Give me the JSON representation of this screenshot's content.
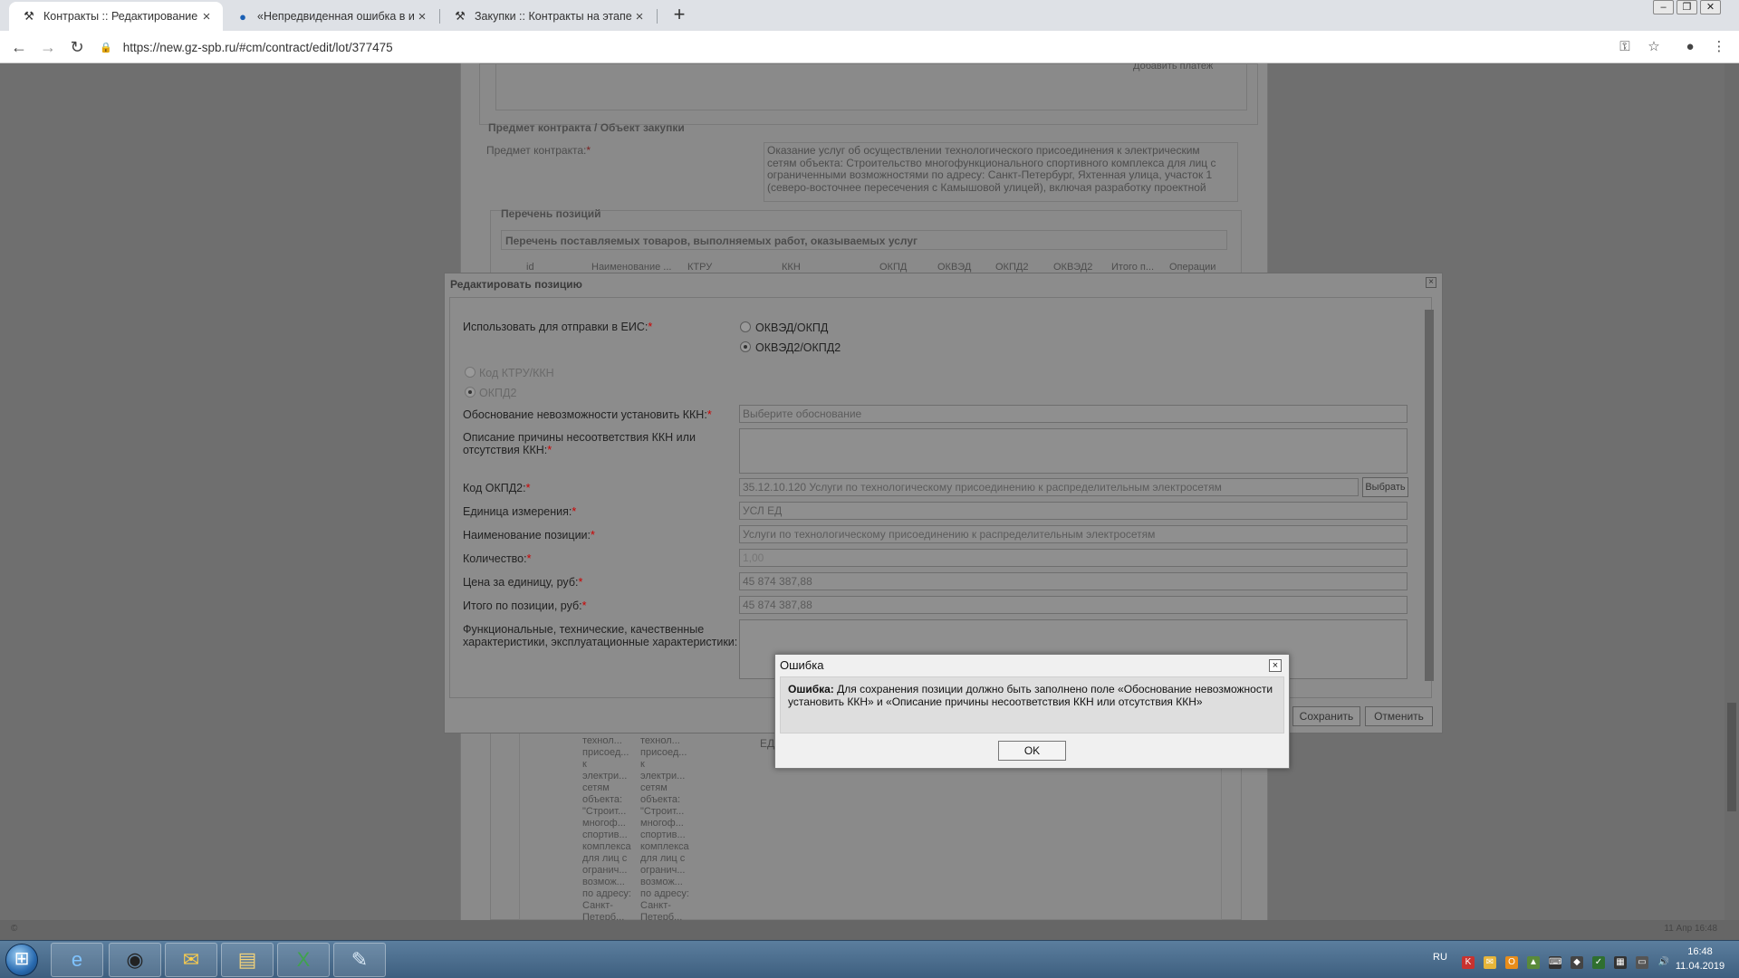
{
  "browser": {
    "tabs": [
      {
        "label": "Контракты :: Редактирование ко",
        "icon": "tool-icon",
        "active": true
      },
      {
        "label": "«Непредвиденная ошибка в ин",
        "icon": "globe-icon",
        "active": false
      },
      {
        "label": "Закупки :: Контракты на этапе и",
        "icon": "tool-icon",
        "active": false
      }
    ],
    "url": "https://new.gz-spb.ru/#cm/contract/edit/lot/377475"
  },
  "background": {
    "add_payment_btn": "Добавить платеж",
    "section_subject": "Предмет контракта / Объект закупки",
    "subject_label": "Предмет контракта:",
    "subject_text": "Оказание услуг об осуществлении технологического присоединения к электрическим сетям объекта: Строительство многофункционального спортивного комплекса для лиц с ограниченными возможностями по адресу: Санкт-Петербург, Яхтенная улица, участок 1 (северо-восточнее пересечения с Камышовой улицей), включая разработку проектной",
    "positions_section": "Перечень позиций",
    "positions_table_title": "Перечень поставляемых товаров, выполняемых работ, оказываемых услуг",
    "columns": [
      "id",
      "Наименование ...",
      "КТРУ",
      "ККН",
      "ОКПД",
      "ОКВЭД",
      "ОКПД2",
      "ОКВЭД2",
      "Итого п...",
      "Операции"
    ],
    "cell_col1": [
      "технол...",
      "присоед...",
      "к",
      "электри...",
      "сетям",
      "объекта:",
      "\"Строит...",
      "многоф...",
      "спортив...",
      "комплекса",
      "для лиц с",
      "огранич...",
      "возмож...",
      "по адресу:",
      "Санкт-",
      "Петерб..."
    ],
    "cell_col2": [
      "технол...",
      "присоед...",
      "к",
      "электри...",
      "сетям",
      "объекта:",
      "\"Строит...",
      "многоф...",
      "спортив...",
      "комплекса",
      "для лиц с",
      "огранич...",
      "возмож...",
      "по адресу:",
      "Санкт-",
      "Петерб..."
    ],
    "cell_unit": "ЕД"
  },
  "edit_dialog": {
    "title": "Редактировать позицию",
    "use_for_eis_label": "Использовать для отправки в ЕИС:",
    "radio_okved_okpd": "ОКВЭД/ОКПД",
    "radio_okved2_okpd2": "ОКВЭД2/ОКПД2",
    "radio_ktru_kkn": "Код КТРУ/ККН",
    "radio_okpd2": "ОКПД2",
    "justification_label": "Обоснование невозможности установить ККН:",
    "justification_placeholder": "Выберите обоснование",
    "reason_label_1": "Описание причины несоответствия ККН или",
    "reason_label_2": "отсутствия ККН:",
    "okpd2_label": "Код ОКПД2:",
    "okpd2_value": "35.12.10.120 Услуги по технологическому присоединению к распределительным электросетям",
    "choose_btn": "Выбрать",
    "unit_label": "Единица измерения:",
    "unit_value": "УСЛ ЕД",
    "name_label": "Наименование позиции:",
    "name_value": "Услуги по технологическому присоединению к распределительным электросетям",
    "qty_label": "Количество:",
    "qty_value": "1,00",
    "price_label": "Цена за единицу, руб:",
    "price_value": "45 874 387,88",
    "total_label": "Итого по позиции, руб:",
    "total_value": "45 874 387,88",
    "func_label_1": "Функциональные, технические, качественные",
    "func_label_2": "характеристики, эксплуатационные характеристики:",
    "save_btn": "Сохранить",
    "cancel_btn": "Отменить"
  },
  "error_dialog": {
    "title": "Ошибка",
    "message_bold": "Ошибка:",
    "message_text": " Для сохранения позиции должно быть заполнено поле «Обоснование невозможности установить ККН» и «Описание причины несоответствия ККН или отсутствия ККН»",
    "ok_btn": "OK"
  },
  "statusbar": {
    "left": "©",
    "right": "11 Апр 16:48"
  },
  "taskbar": {
    "lang": "RU",
    "time": "16:48",
    "date": "11.04.2019"
  }
}
